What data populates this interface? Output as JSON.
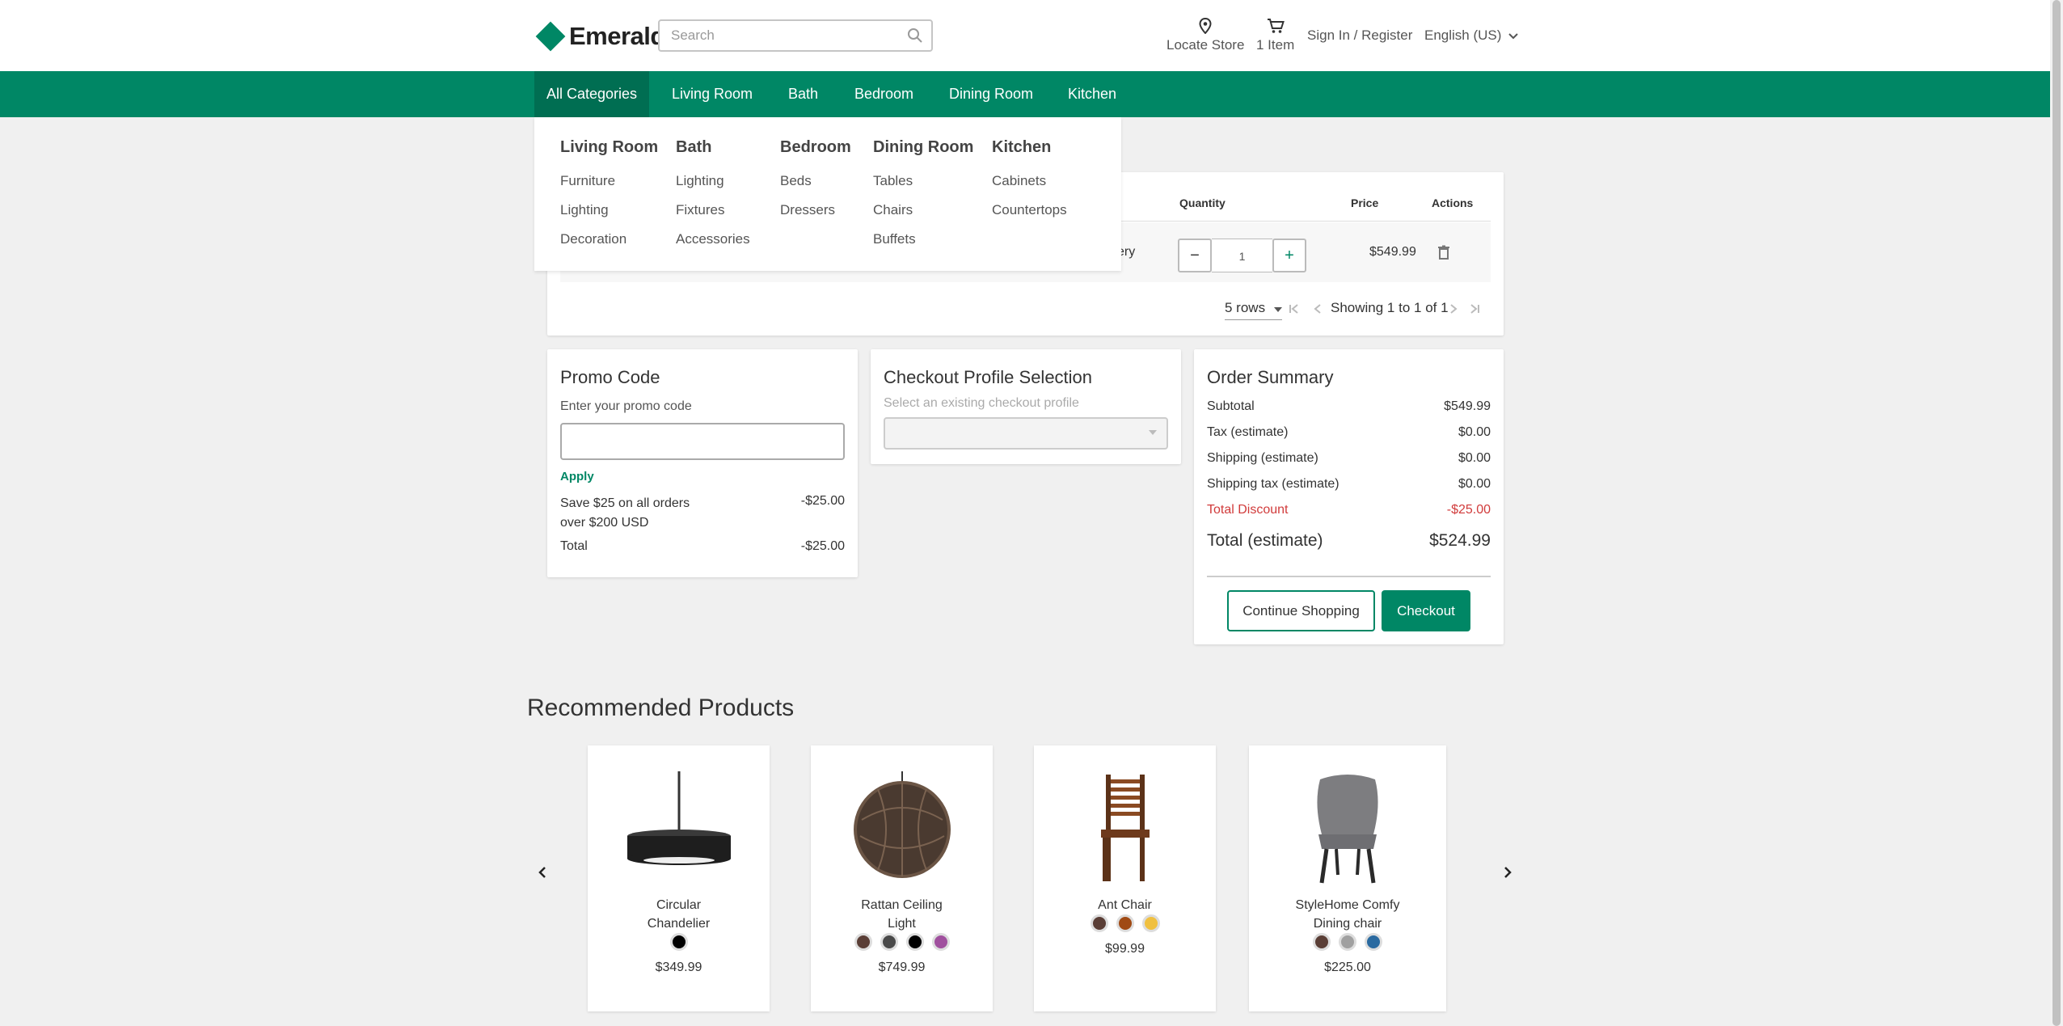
{
  "brand": {
    "name": "Emerald",
    "color": "#008765"
  },
  "header": {
    "search_placeholder": "Search",
    "locate_store": "Locate Store",
    "cart_label": "1 Item",
    "sign_in": "Sign In / Register",
    "language": "English (US)"
  },
  "nav": {
    "items": [
      "All Categories",
      "Living Room",
      "Bath",
      "Bedroom",
      "Dining Room",
      "Kitchen"
    ]
  },
  "mega_menu": {
    "columns": [
      {
        "title": "Living Room",
        "links": [
          "Furniture",
          "Lighting",
          "Decoration"
        ]
      },
      {
        "title": "Bath",
        "links": [
          "Lighting",
          "Fixtures",
          "Accessories"
        ]
      },
      {
        "title": "Bedroom",
        "links": [
          "Beds",
          "Dressers"
        ]
      },
      {
        "title": "Dining Room",
        "links": [
          "Tables",
          "Chairs",
          "Buffets"
        ]
      },
      {
        "title": "Kitchen",
        "links": [
          "Cabinets",
          "Countertops"
        ]
      }
    ]
  },
  "cart": {
    "headers": {
      "quantity": "Quantity",
      "price": "Price",
      "actions": "Actions"
    },
    "row": {
      "partial_text": "ery",
      "quantity": "1",
      "price": "$549.99"
    },
    "pagination": {
      "rows": "5 rows",
      "showing": "Showing 1 to 1 of 1"
    }
  },
  "promo": {
    "title": "Promo Code",
    "label": "Enter your promo code",
    "apply": "Apply",
    "discount_desc": "Save $25 on all orders over $200 USD",
    "discount_amount": "-$25.00",
    "total_label": "Total",
    "total_amount": "-$25.00"
  },
  "profile": {
    "title": "Checkout Profile Selection",
    "placeholder": "Select an existing checkout profile"
  },
  "summary": {
    "title": "Order Summary",
    "rows": [
      {
        "label": "Subtotal",
        "value": "$549.99"
      },
      {
        "label": "Tax (estimate)",
        "value": "$0.00"
      },
      {
        "label": "Shipping (estimate)",
        "value": "$0.00"
      },
      {
        "label": "Shipping tax (estimate)",
        "value": "$0.00"
      },
      {
        "label": "Total Discount",
        "value": "-$25.00"
      }
    ],
    "total_label": "Total (estimate)",
    "total_value": "$524.99",
    "continue_shopping": "Continue Shopping",
    "checkout": "Checkout",
    "discount_color": "#d13b3b"
  },
  "recommended": {
    "title": "Recommended Products",
    "products": [
      {
        "name": "Circular Chandelier",
        "price": "$349.99",
        "swatches": [
          "#000000"
        ]
      },
      {
        "name": "Rattan Ceiling Light",
        "price": "$749.99",
        "swatches": [
          "#5a3e36",
          "#4a4a4a",
          "#000000",
          "#a0509e"
        ]
      },
      {
        "name": "Ant Chair",
        "price": "$99.99",
        "swatches": [
          "#5a3e36",
          "#a04a14",
          "#f0c040"
        ]
      },
      {
        "name": "StyleHome Comfy Dining chair",
        "price": "$225.00",
        "swatches": [
          "#5a3e36",
          "#a0a0a0",
          "#2a6aa0"
        ]
      }
    ]
  }
}
